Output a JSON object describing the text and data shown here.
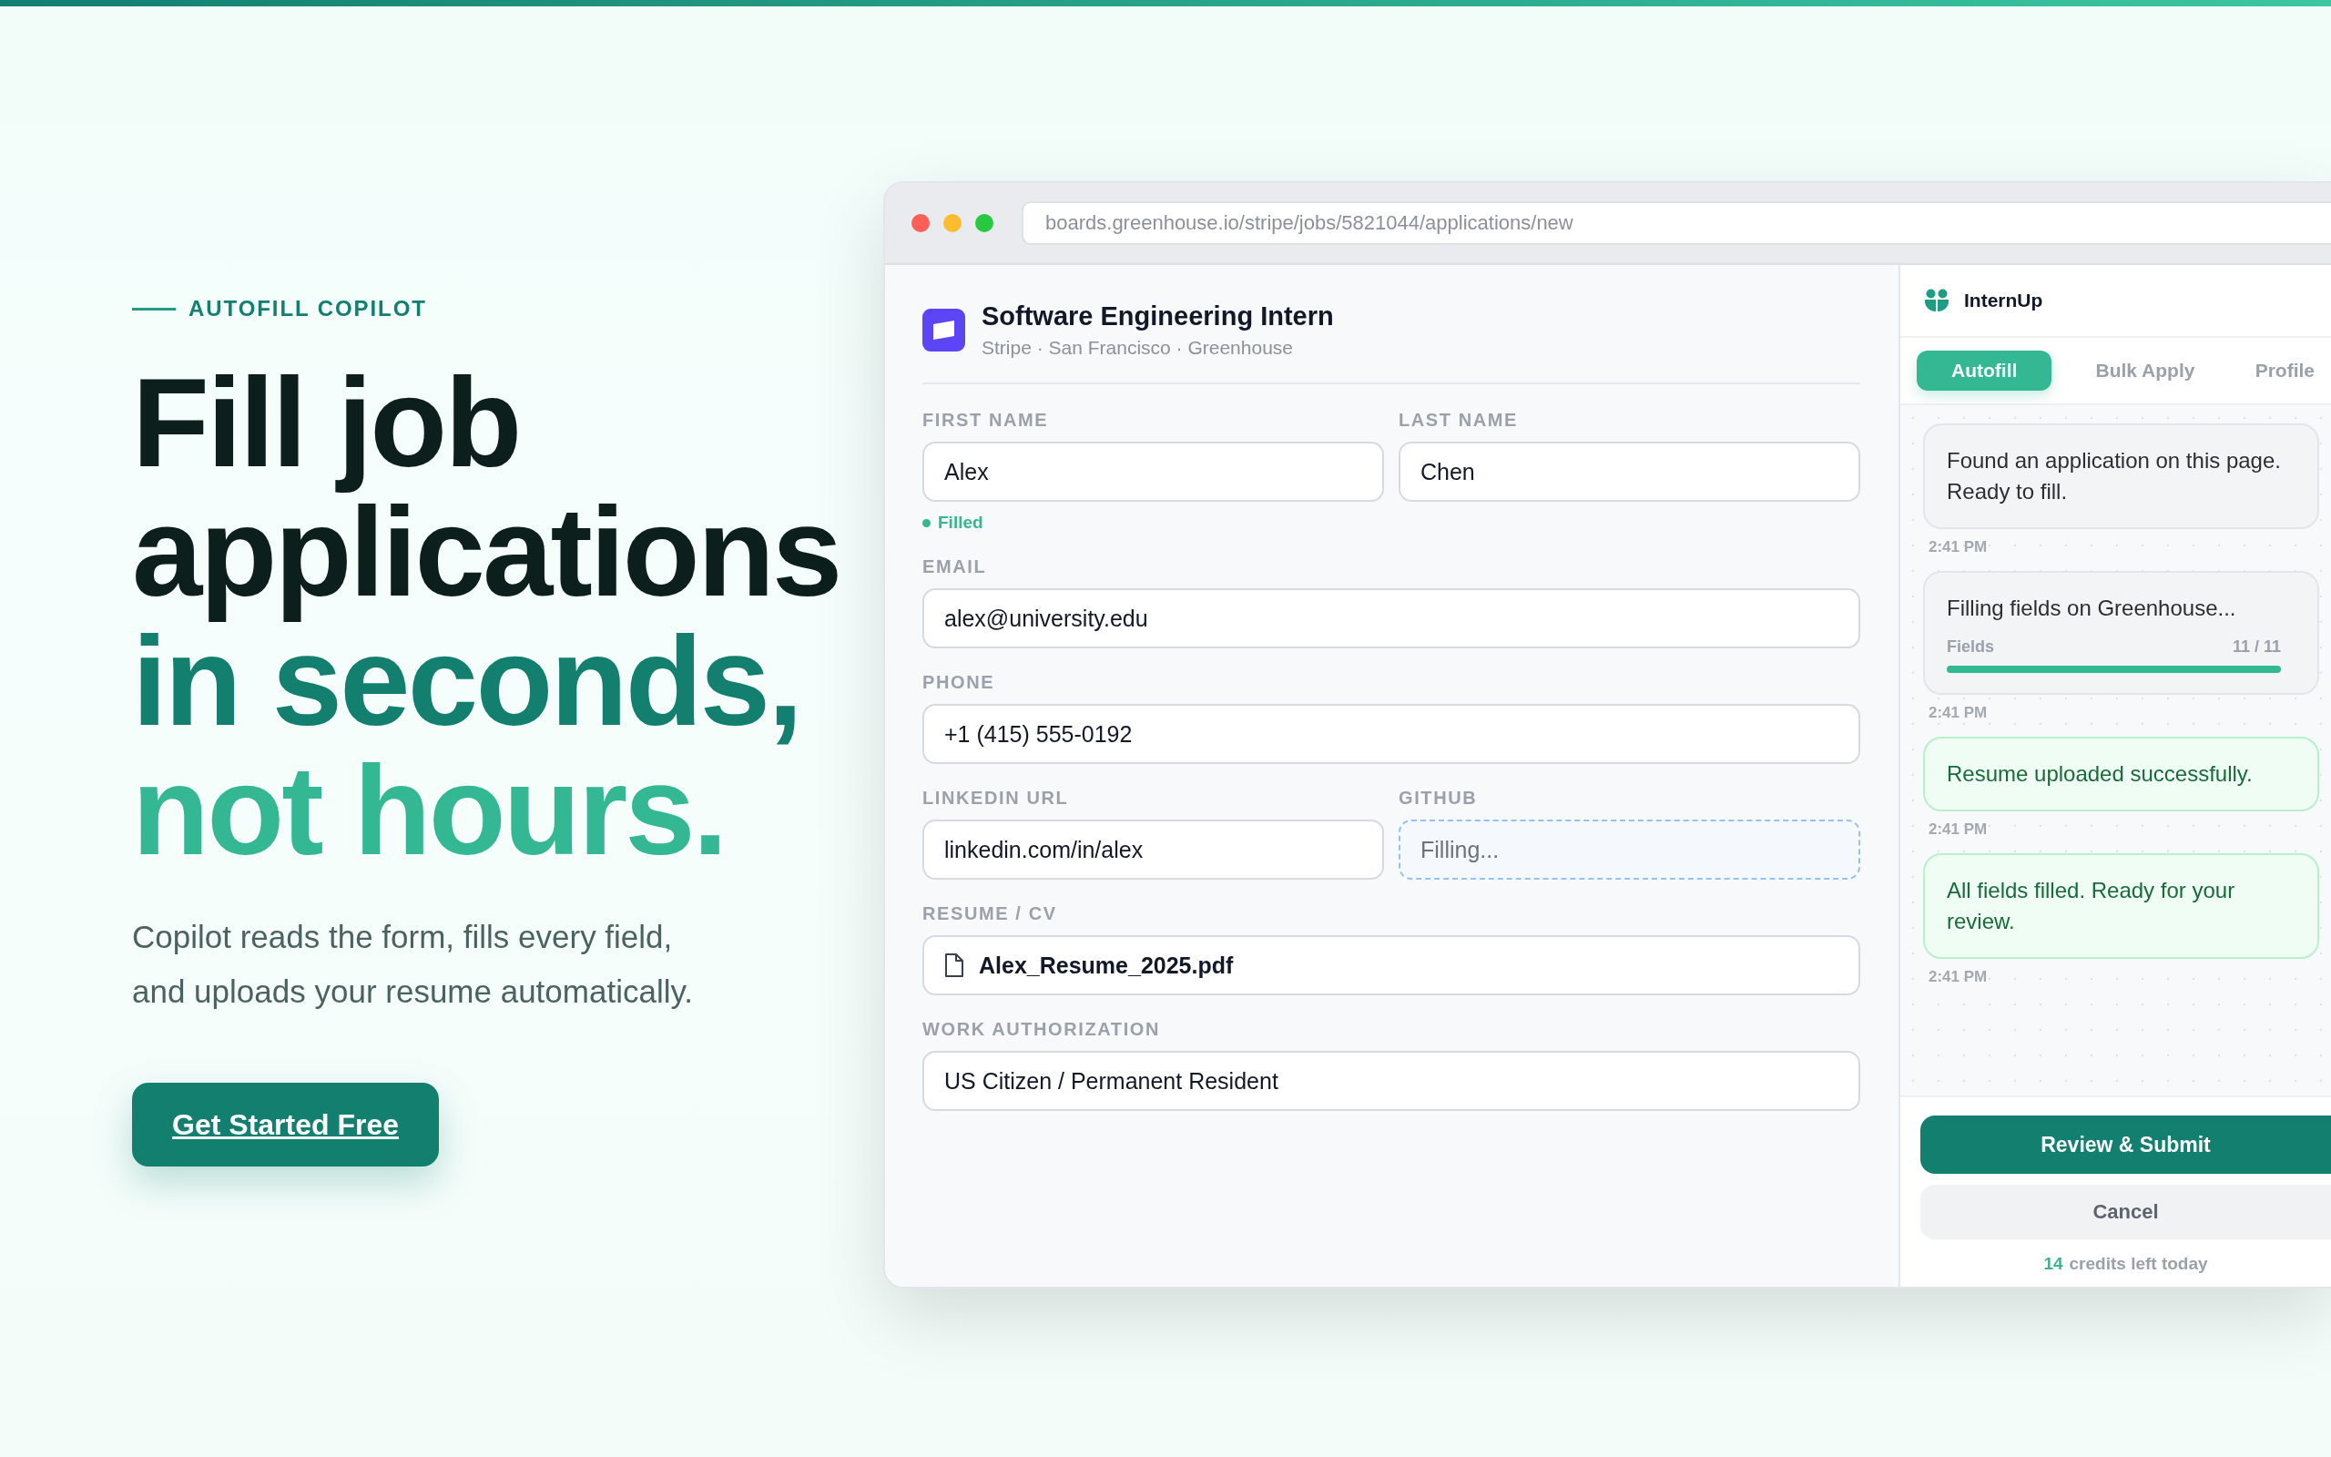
{
  "hero": {
    "eyebrow": "AUTOFILL COPILOT",
    "headline": [
      {
        "text": "Fill job",
        "color": "#0d1f1c"
      },
      {
        "text": "applications",
        "color": "#0d1f1c"
      },
      {
        "text": "in seconds,",
        "color": "#13806f"
      },
      {
        "text": "not hours.",
        "color": "#34b893"
      }
    ],
    "description": "Copilot reads the form, fills every field, and uploads your resume automatically.",
    "cta": "Get Started Free"
  },
  "browser": {
    "url": "boards.greenhouse.io/stripe/jobs/5821044/applications/new",
    "job": {
      "title": "Software Engineering Intern",
      "subtitle": "Stripe · San Francisco · Greenhouse"
    },
    "rows": [
      {
        "fields": [
          {
            "label": "FIRST NAME",
            "value": "Alex",
            "kind": "text"
          },
          {
            "label": "LAST NAME",
            "value": "Chen",
            "kind": "text"
          }
        ],
        "note": "Filled"
      },
      {
        "fields": [
          {
            "label": "EMAIL",
            "value": "alex@university.edu",
            "kind": "text"
          }
        ]
      },
      {
        "fields": [
          {
            "label": "PHONE",
            "value": "+1 (415) 555-0192",
            "kind": "text"
          }
        ]
      },
      {
        "fields": [
          {
            "label": "LINKEDIN URL",
            "value": "linkedin.com/in/alex",
            "kind": "text"
          },
          {
            "label": "GITHUB",
            "placeholder": "Filling...",
            "kind": "filling"
          }
        ]
      },
      {
        "fields": [
          {
            "label": "RESUME / CV",
            "value": "Alex_Resume_2025.pdf",
            "kind": "file"
          }
        ]
      },
      {
        "fields": [
          {
            "label": "WORK AUTHORIZATION",
            "value": "US Citizen / Permanent Resident",
            "kind": "text"
          }
        ]
      }
    ]
  },
  "sidebar": {
    "brand": "InternUp",
    "tabs": [
      {
        "label": "Autofill",
        "selected": true
      },
      {
        "label": "Bulk Apply",
        "selected": false
      },
      {
        "label": "Profile",
        "selected": false
      }
    ],
    "messages": [
      {
        "kind": "info",
        "text": "Found an application on this page. Ready to fill.",
        "time": "2:41 PM"
      },
      {
        "kind": "progress",
        "text": "Filling fields on Greenhouse...",
        "progress_label": "Fields",
        "progress_count": "11 / 11",
        "level": 1,
        "time": "2:41 PM"
      },
      {
        "kind": "success",
        "text": "Resume uploaded successfully.",
        "time": "2:41 PM"
      },
      {
        "kind": "success",
        "text": "All fields filled. Ready for your review.",
        "time": "2:41 PM"
      }
    ],
    "primary_button": "Review & Submit",
    "secondary_button": "Cancel",
    "credits": {
      "count": "14",
      "label": "credits left today"
    }
  }
}
